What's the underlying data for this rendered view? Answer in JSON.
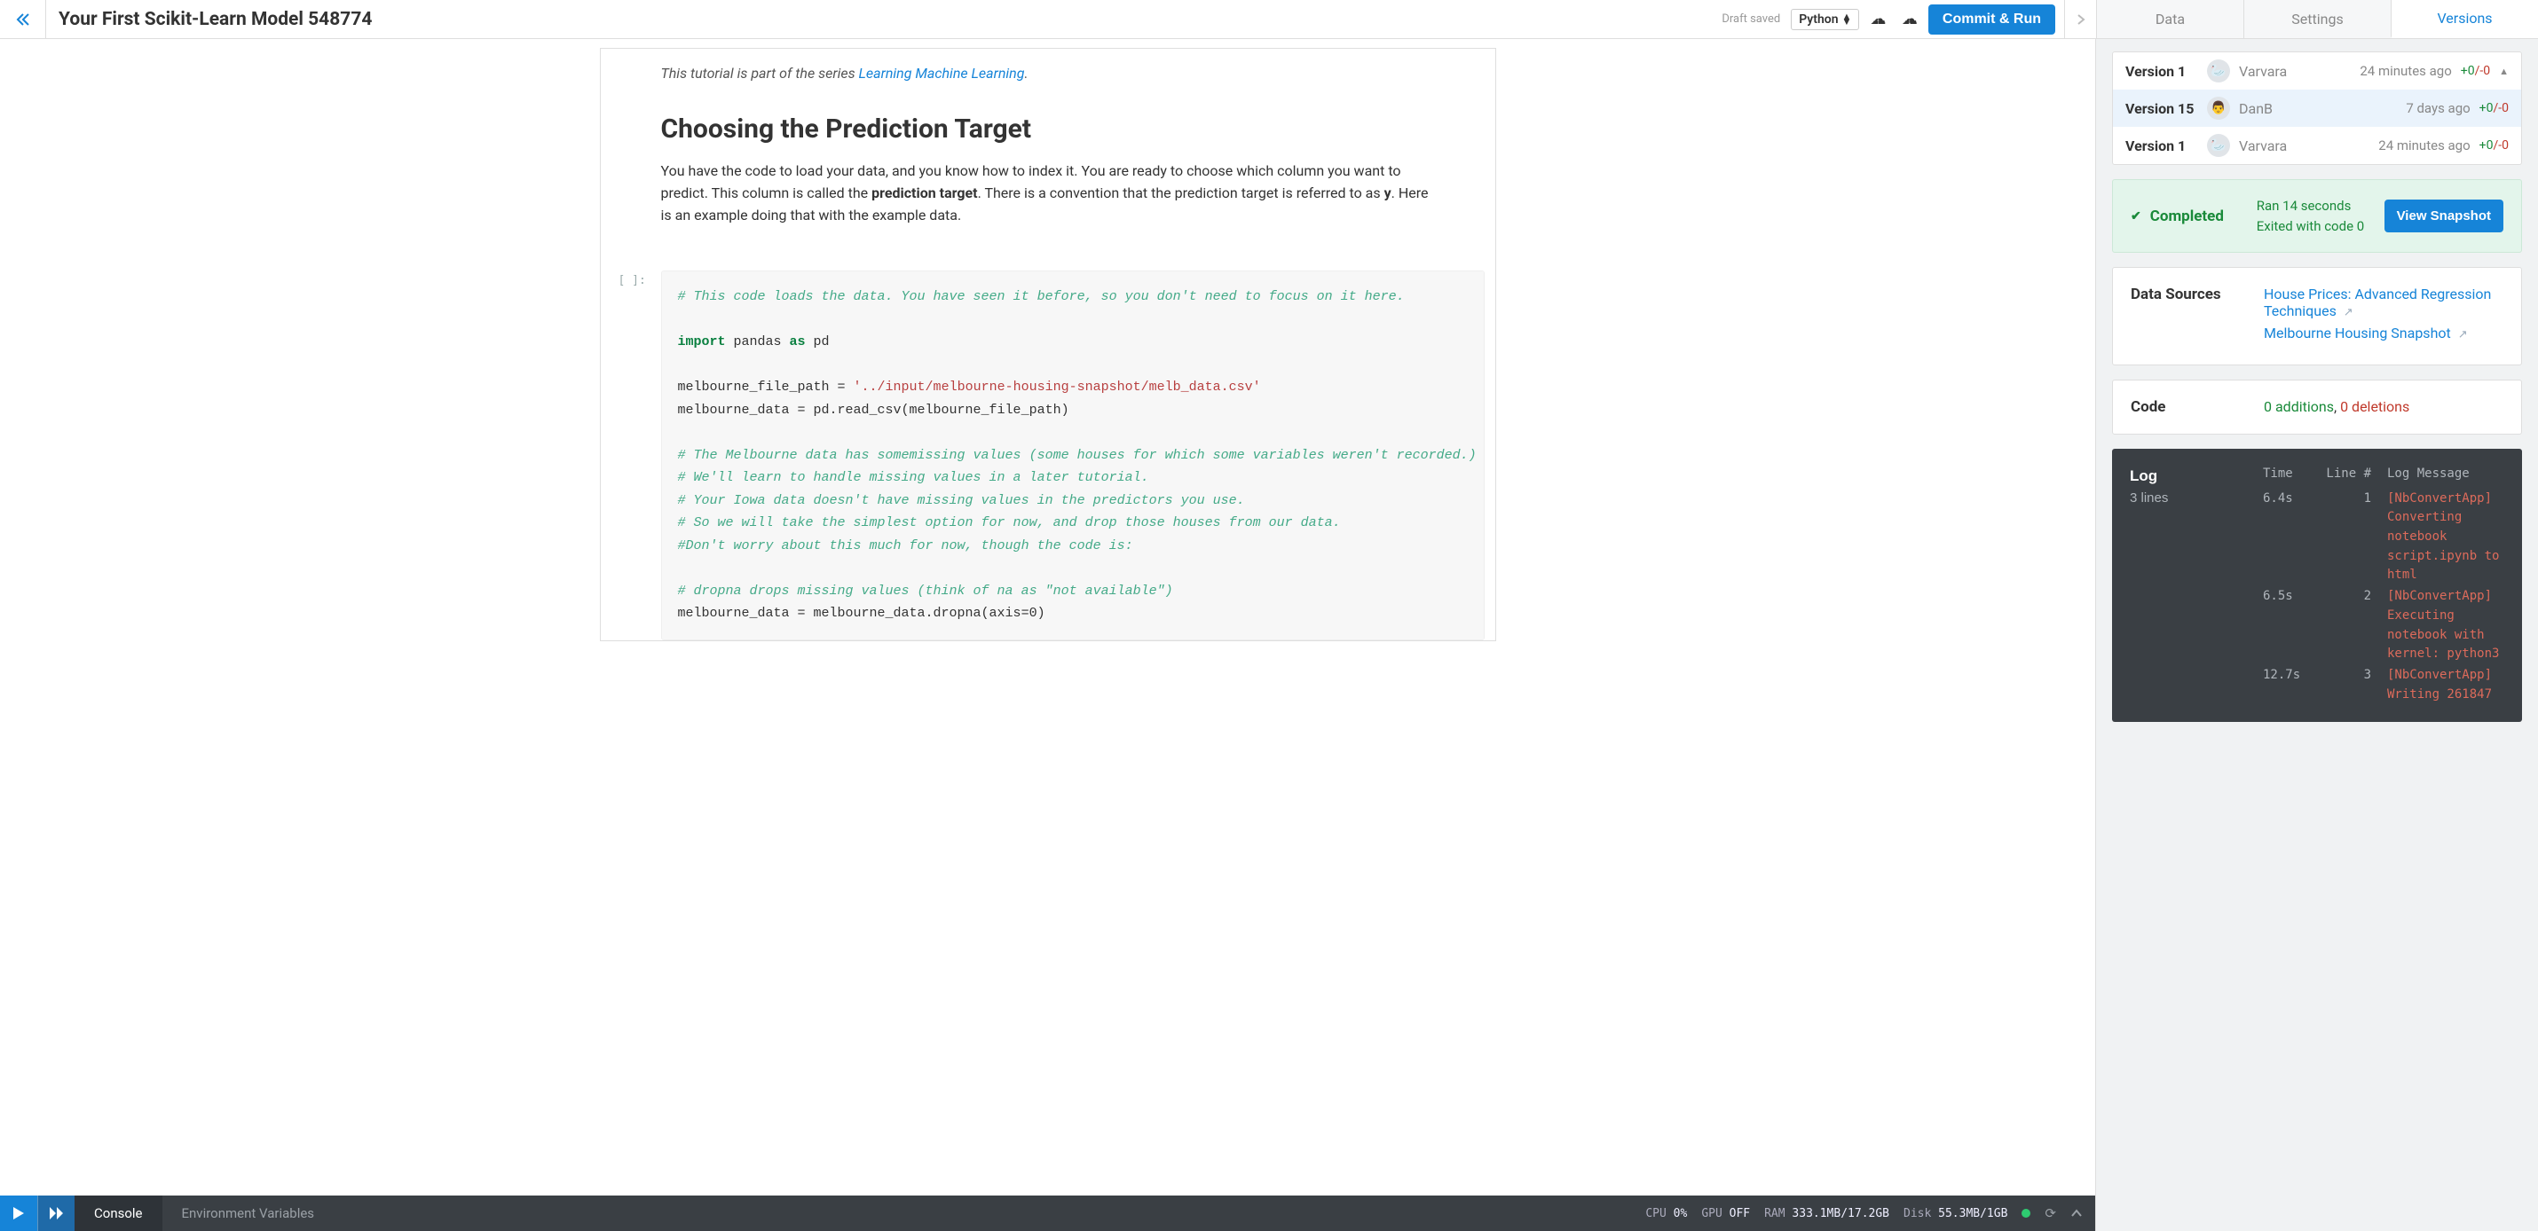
{
  "toolbar": {
    "title": "Your First Scikit-Learn Model 548774",
    "draft_saved": "Draft saved",
    "language": "Python",
    "commit_label": "Commit & Run",
    "tabs": {
      "data": "Data",
      "settings": "Settings",
      "versions": "Versions"
    }
  },
  "notebook": {
    "series_prefix": "This tutorial is part of the series ",
    "series_link": "Learning Machine Learning",
    "series_suffix": ".",
    "h1": "Choosing the Prediction Target",
    "para_html": "You have the code to load your data, and you know how to index it. You are ready to choose which column you want to predict. This column is called the <b>prediction target</b>. There is a convention that the prediction target is referred to as <b>y</b>. Here is an example doing that with the example data.",
    "code_prompt": "[ ]:",
    "code": {
      "l1": "# This code loads the data. You have seen it before, so you don't need to focus on it here.",
      "l2": "",
      "l3_a": "import",
      "l3_b": " pandas ",
      "l3_c": "as",
      "l3_d": " pd",
      "l4": "",
      "l5_a": "melbourne_file_path = ",
      "l5_b": "'../input/melbourne-housing-snapshot/melb_data.csv'",
      "l6": "melbourne_data = pd.read_csv(melbourne_file_path)",
      "l7": "",
      "l8": "# The Melbourne data has somemissing values (some houses for which some variables weren't recorded.)",
      "l9": "# We'll learn to handle missing values in a later tutorial.  ",
      "l10": "# Your Iowa data doesn't have missing values in the predictors you use. ",
      "l11": "# So we will take the simplest option for now, and drop those houses from our data. ",
      "l12": "#Don't worry about this much for now, though the code is:",
      "l13": "",
      "l14": "# dropna drops missing values (think of na as \"not available\")",
      "l15": "melbourne_data = melbourne_data.dropna(axis=0)"
    }
  },
  "console": {
    "tab_console": "Console",
    "tab_env": "Environment Variables",
    "cpu_label": "CPU",
    "cpu_val": "0%",
    "gpu_label": "GPU",
    "gpu_val": "OFF",
    "ram_label": "RAM",
    "ram_val": "333.1MB/17.2GB",
    "disk_label": "Disk",
    "disk_val": "55.3MB/1GB"
  },
  "versions": {
    "items": [
      {
        "name": "Version 1",
        "user": "Varvara",
        "time": "24 minutes ago",
        "plus": "+0",
        "minus": "/-0",
        "expand": true,
        "avatar": "🦢"
      },
      {
        "name": "Version 15",
        "user": "DanB",
        "time": "7 days ago",
        "plus": "+0",
        "minus": "/-0",
        "selected": true,
        "avatar": "👨"
      },
      {
        "name": "Version 1",
        "user": "Varvara",
        "time": "24 minutes ago",
        "plus": "+0",
        "minus": "/-0",
        "avatar": "🦢"
      }
    ]
  },
  "status": {
    "label": "Completed",
    "line1": "Ran 14 seconds",
    "line2": "Exited with code 0",
    "button": "View Snapshot"
  },
  "data_sources": {
    "title": "Data Sources",
    "links": [
      "House Prices: Advanced Regression Techniques",
      "Melbourne Housing Snapshot"
    ]
  },
  "code_diff": {
    "title": "Code",
    "additions": "0 additions",
    "deletions": "0 deletions"
  },
  "log": {
    "title": "Log",
    "subtitle": "3 lines",
    "head_time": "Time",
    "head_line": "Line #",
    "head_msg": "Log Message",
    "entries": [
      {
        "t": "6.4s",
        "n": "1",
        "m": "[NbConvertApp] Converting notebook script.ipynb to html"
      },
      {
        "t": "6.5s",
        "n": "2",
        "m": "[NbConvertApp] Executing notebook with kernel: python3"
      },
      {
        "t": "12.7s",
        "n": "3",
        "m": "[NbConvertApp] Writing 261847"
      }
    ]
  }
}
